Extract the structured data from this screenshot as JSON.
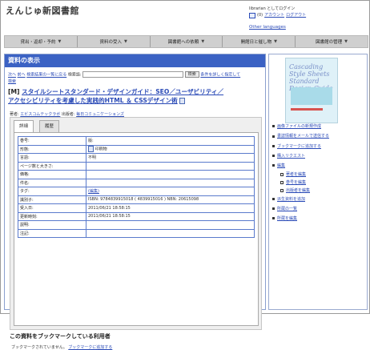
{
  "header": {
    "site_title": "えんじゅ新図書館",
    "login_status": "librarian としてログイン",
    "cart_count": "(0)",
    "account_link": "アカウント",
    "logout_link": "ログアウト",
    "other_languages": "Other languages"
  },
  "nav": [
    {
      "label": "貸出・返却・予約"
    },
    {
      "label": "資料の受入"
    },
    {
      "label": "図書館への依頼"
    },
    {
      "label": "開館日と催し物"
    },
    {
      "label": "図書館の管理"
    }
  ],
  "main": {
    "panel_title": "資料の表示",
    "prev_link": "次へ",
    "next_link": "前へ",
    "results_link": "検索結果の一覧に戻る",
    "search_label": "検索語:",
    "search_button": "検索",
    "advanced_link": "条件を詳しく指定して",
    "advanced_link2": "検索",
    "material_type_badge": "[M]",
    "book_title_line1": "スタイルシートスタンダード・デザインガイド：SEO／ユーザビリティ／",
    "book_title_line2": "アクセシビリティを考慮した実践的HTML ＆ CSSデザイン術",
    "authors_label": "著者:",
    "author_link": "エビスコムテックラボ",
    "publisher_label": "出版者:",
    "publisher_link": "毎日コミュニケーションズ",
    "tabs": [
      {
        "label": "詳細"
      },
      {
        "label": "履歴"
      }
    ],
    "attributes": [
      {
        "key": "巻号:",
        "value": "",
        "extra": "版:"
      },
      {
        "key": "形態:",
        "value": "印刷物",
        "extra": ""
      },
      {
        "key": "言語:",
        "value": "不明",
        "extra": ""
      },
      {
        "key": "ページ数と大きさ:",
        "value": "",
        "extra": ""
      },
      {
        "key": "価格:",
        "value": "",
        "extra": ""
      },
      {
        "key": "件名:",
        "value": "",
        "extra": ""
      },
      {
        "key": "タグ:",
        "value": "(編集)",
        "extra": ""
      },
      {
        "key": "識別子:",
        "value": "ISBN: 9784839915018 ( 4839915016 ) NBN: 20615098",
        "extra": ""
      },
      {
        "key": "受入日:",
        "value": "2011/06/21 18:58:15",
        "extra": ""
      },
      {
        "key": "更新時刻:",
        "value": "2011/06/21 18:58:15",
        "extra": ""
      },
      {
        "key": "説明:",
        "value": "",
        "extra": ""
      },
      {
        "key": "注記:",
        "value": "",
        "extra": ""
      }
    ],
    "bookmark_heading": "この資料をブックマークしている利用者",
    "bookmark_empty": "ブックマークされていません。",
    "bookmark_add": "ブックマークに追加する"
  },
  "sidebar": {
    "cover_text": "Cascading Style Sheets Standard Design Guide",
    "items": [
      {
        "label": "画像ファイルの新規作成"
      },
      {
        "label": "書誌情報をメールで送信する"
      },
      {
        "label": "ブックマークに追加する"
      },
      {
        "label": "購入リクエスト"
      },
      {
        "label": "編集"
      },
      {
        "label": "著者を編集",
        "sub": true
      },
      {
        "label": "巻号を編集",
        "sub": true
      },
      {
        "label": "出版者を編集",
        "sub": true
      },
      {
        "label": "派生資料を追加"
      },
      {
        "label": "所蔵の一覧"
      },
      {
        "label": "所蔵を編集"
      }
    ]
  }
}
